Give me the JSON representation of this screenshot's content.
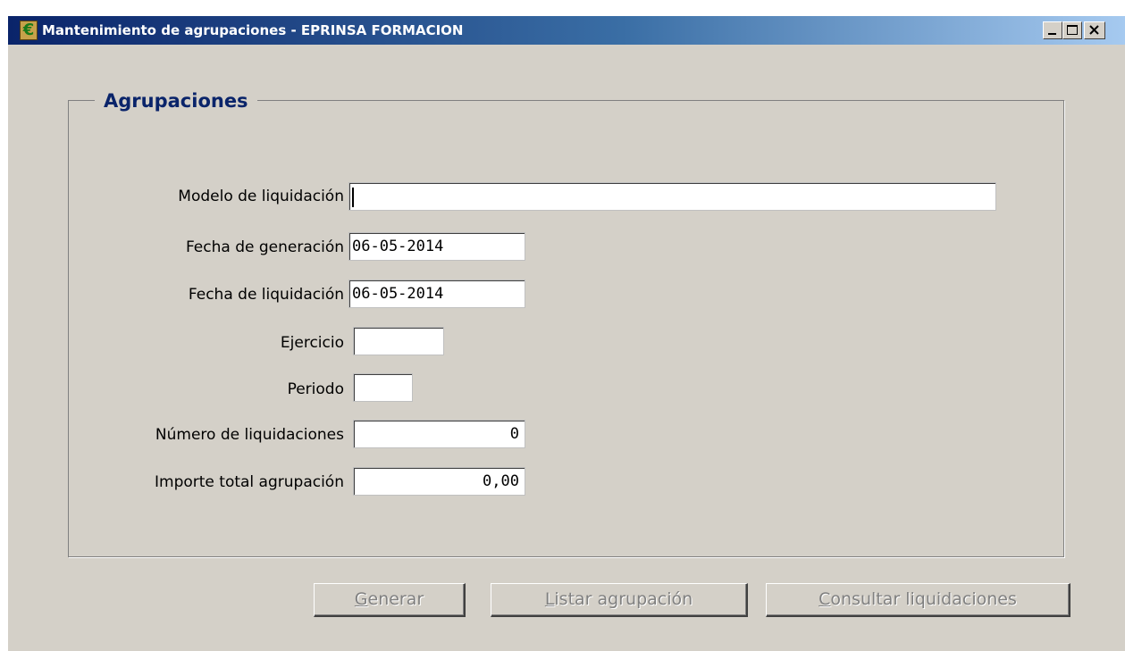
{
  "window": {
    "title": "Mantenimiento de agrupaciones - EPRINSA FORMACION",
    "icon": "euro-icon",
    "controls": [
      "minimize-icon",
      "maximize-icon",
      "close-icon"
    ]
  },
  "group": {
    "title": "Agrupaciones"
  },
  "form": {
    "modelo": {
      "label": "Modelo de liquidación",
      "value": ""
    },
    "fecha_generacion": {
      "label": "Fecha de generación",
      "value": "06-05-2014"
    },
    "fecha_liquidacion": {
      "label": "Fecha de liquidación",
      "value": "06-05-2014"
    },
    "ejercicio": {
      "label": "Ejercicio",
      "value": ""
    },
    "periodo": {
      "label": "Periodo",
      "value": ""
    },
    "numero_liquidaciones": {
      "label": "Número de liquidaciones",
      "value": "0"
    },
    "importe_total": {
      "label": "Importe total agrupación",
      "value": "0,00"
    }
  },
  "buttons": {
    "generar": {
      "label": "Generar",
      "accel": "G",
      "rest": "enerar",
      "enabled": false
    },
    "listar": {
      "label": "Listar agrupación",
      "accel": "L",
      "rest": "istar agrupación",
      "enabled": false
    },
    "consultar": {
      "label": "Consultar liquidaciones",
      "accel": "C",
      "rest": "onsultar liquidaciones",
      "enabled": false
    }
  },
  "colors": {
    "titlebar_start": "#0a246a",
    "titlebar_end": "#a6caf0",
    "face": "#d4d0c8",
    "group_title": "#0a246a",
    "disabled_text": "#808080"
  }
}
